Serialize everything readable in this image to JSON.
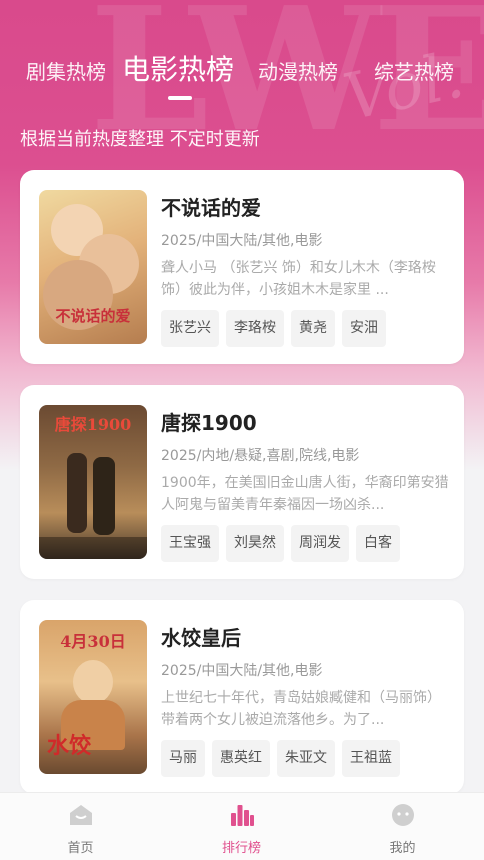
{
  "header": {
    "tabs": [
      {
        "label": "剧集热榜",
        "active": false
      },
      {
        "label": "电影热榜",
        "active": true
      },
      {
        "label": "动漫热榜",
        "active": false
      },
      {
        "label": "综艺热榜",
        "active": false
      }
    ],
    "subtitle": "根据当前热度整理 不定时更新"
  },
  "movies": [
    {
      "title": "不说话的爱",
      "meta": "2025/中国大陆/其他,电影",
      "desc": "聋人小马 （张艺兴 饰）和女儿木木（李珞桉 饰）彼此为伴，小孩姐木木是家里 ...",
      "actors": [
        "张艺兴",
        "李珞桉",
        "黄尧",
        "安沺"
      ],
      "poster_text": "不说话的爱",
      "poster_colors": [
        "#e9c98a",
        "#d9a36a",
        "#8a6a4a"
      ]
    },
    {
      "title": "唐探1900",
      "meta": "2025/内地/悬疑,喜剧,院线,电影",
      "desc": "1900年，在美国旧金山唐人街，华裔印第安猎人阿鬼与留美青年秦福因一场凶杀...",
      "actors": [
        "王宝强",
        "刘昊然",
        "周润发",
        "白客"
      ],
      "poster_text": "唐探1900",
      "poster_colors": [
        "#5a4a3a",
        "#8a6a4a",
        "#c9a56a"
      ]
    },
    {
      "title": "水饺皇后",
      "meta": "2025/中国大陆/其他,电影",
      "desc": "上世纪七十年代，青岛姑娘臧健和（马丽饰）带着两个女儿被迫流落他乡。为了...",
      "actors": [
        "马丽",
        "惠英红",
        "朱亚文",
        "王祖蓝"
      ],
      "poster_text": "4月30日",
      "poster_colors": [
        "#c98a5a",
        "#e0b07a",
        "#7a5a3a"
      ]
    }
  ],
  "nav": [
    {
      "label": "首页",
      "icon": "home-icon",
      "active": false
    },
    {
      "label": "排行榜",
      "icon": "ranking-icon",
      "active": true
    },
    {
      "label": "我的",
      "icon": "profile-icon",
      "active": false
    }
  ],
  "colors": {
    "accent": "#e0508e",
    "hero": "#d94a8c"
  }
}
